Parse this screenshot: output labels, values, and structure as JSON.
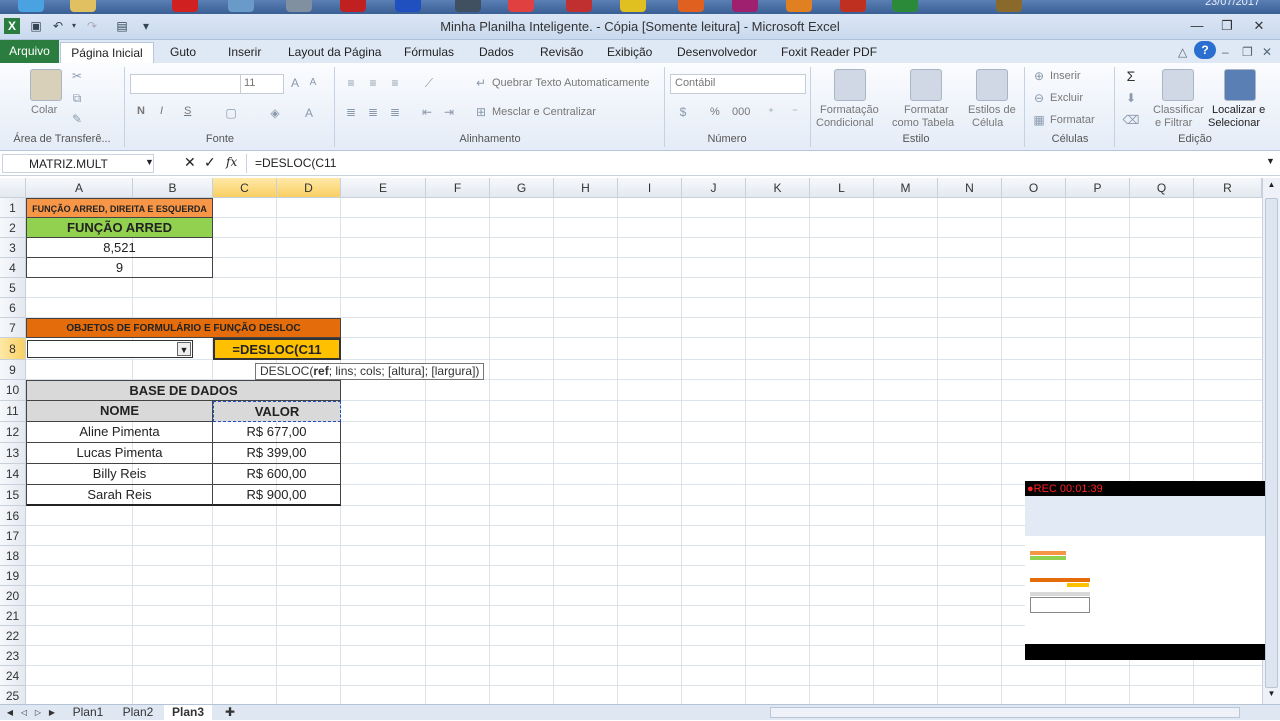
{
  "taskbar": {
    "date": "23/07/2017"
  },
  "window": {
    "title": "Minha Planilha Inteligente. - Cópia  [Somente leitura]  -  Microsoft Excel"
  },
  "ribbon_tabs": [
    "Arquivo",
    "Página Inicial",
    "Guto",
    "Inserir",
    "Layout da Página",
    "Fórmulas",
    "Dados",
    "Revisão",
    "Exibição",
    "Desenvolvedor",
    "Foxit Reader PDF"
  ],
  "ribbon": {
    "clipboard": {
      "paste": "Colar",
      "group": "Área de Transferê..."
    },
    "font": {
      "size": "11",
      "bold": "N",
      "italic": "I",
      "underline": "S",
      "group": "Fonte"
    },
    "alignment": {
      "wrap": "Quebrar Texto Automaticamente",
      "merge": "Mesclar e Centralizar",
      "group": "Alinhamento"
    },
    "number": {
      "format": "Contábil",
      "percent": "%",
      "thousands": "000",
      "group": "Número"
    },
    "styles": {
      "cond1": "Formatação",
      "cond2": "Condicional",
      "table1": "Formatar",
      "table2": "como Tabela",
      "cell1": "Estilos de",
      "cell2": "Célula",
      "group": "Estilo"
    },
    "cells": {
      "insert": "Inserir",
      "delete": "Excluir",
      "format": "Formatar",
      "group": "Células"
    },
    "editing": {
      "sort1": "Classificar",
      "sort2": "e Filtrar",
      "find1": "Localizar e",
      "find2": "Selecionar",
      "group": "Edição"
    }
  },
  "formula_bar": {
    "name_box": "MATRIZ.MULT",
    "fx": "fx",
    "formula": "=DESLOC(C11"
  },
  "columns": [
    "A",
    "B",
    "C",
    "D",
    "E",
    "F",
    "G",
    "H",
    "I",
    "J",
    "K",
    "L",
    "M",
    "N",
    "O",
    "P",
    "Q",
    "R"
  ],
  "rows": [
    "1",
    "2",
    "3",
    "4",
    "5",
    "6",
    "7",
    "8",
    "9",
    "10",
    "11",
    "12",
    "13",
    "14",
    "15",
    "16",
    "17",
    "18",
    "19",
    "20",
    "21",
    "22",
    "23",
    "24",
    "25"
  ],
  "cells": {
    "r1": "FUNÇÃO ARRED, DIREITA E ESQUERDA",
    "r2": "FUNÇÃO ARRED",
    "r3": "8,521",
    "r4": "9",
    "r7": "OBJETOS DE FORMULÁRIO E FUNÇÃO DESLOC",
    "r8_edit": "=DESLOC(C11",
    "r10": "BASE DE DADOS",
    "hdr_nome": "NOME",
    "hdr_valor": "VALOR",
    "data": [
      {
        "nome": "Aline Pimenta",
        "valor": "R$ 677,00"
      },
      {
        "nome": "Lucas Pimenta",
        "valor": "R$ 399,00"
      },
      {
        "nome": "Billy Reis",
        "valor": "R$ 600,00"
      },
      {
        "nome": "Sarah Reis",
        "valor": "R$ 900,00"
      }
    ]
  },
  "tooltip": {
    "fn": "DESLOC(",
    "ref": "ref",
    "rest": "; lins; cols; [altura]; [largura])"
  },
  "sheets": [
    "Plan1",
    "Plan2",
    "Plan3"
  ],
  "recording": {
    "label": "●REC 00:01:39"
  },
  "colors": {
    "orange_header": "#f79646",
    "dark_orange": "#e46c0a",
    "green": "#92d050",
    "active_cell": "#ffc000",
    "gray_header": "#d9d9d9"
  }
}
